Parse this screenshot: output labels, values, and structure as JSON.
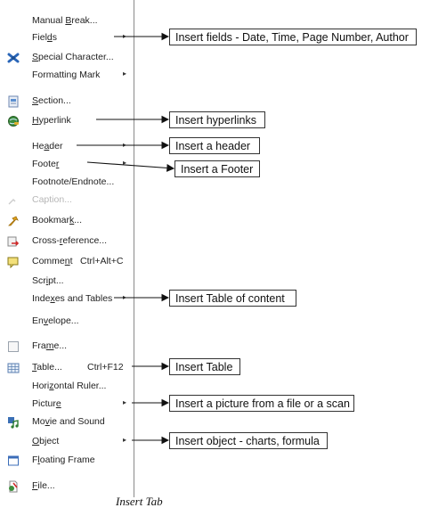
{
  "menu": {
    "items": [
      {
        "pre": "Manual ",
        "acc": "B",
        "post": "reak...",
        "icon": "",
        "shortcut": "",
        "submenu": false,
        "disabled": false
      },
      {
        "pre": "Fiel",
        "acc": "d",
        "post": "s",
        "icon": "",
        "shortcut": "",
        "submenu": true,
        "disabled": false
      },
      {
        "pre": "",
        "acc": "S",
        "post": "pecial Character...",
        "icon": "special-character-icon",
        "shortcut": "",
        "submenu": false,
        "disabled": false
      },
      {
        "pre": "Formatting Mark",
        "acc": "",
        "post": "",
        "icon": "",
        "shortcut": "",
        "submenu": true,
        "disabled": false
      },
      {
        "pre": "",
        "acc": "S",
        "post": "ection...",
        "icon": "section-icon",
        "shortcut": "",
        "submenu": false,
        "disabled": false
      },
      {
        "pre": "",
        "acc": "H",
        "post": "yperlink",
        "icon": "hyperlink-icon",
        "shortcut": "",
        "submenu": false,
        "disabled": false
      },
      {
        "pre": "He",
        "acc": "a",
        "post": "der",
        "icon": "",
        "shortcut": "",
        "submenu": true,
        "disabled": false
      },
      {
        "pre": "Foote",
        "acc": "r",
        "post": "",
        "icon": "",
        "shortcut": "",
        "submenu": true,
        "disabled": false
      },
      {
        "pre": "Footnote/Endnote",
        "acc": "",
        "post": "...",
        "icon": "",
        "shortcut": "",
        "submenu": false,
        "disabled": false
      },
      {
        "pre": "Caption...",
        "acc": "",
        "post": "",
        "icon": "caption-icon",
        "shortcut": "",
        "submenu": false,
        "disabled": true
      },
      {
        "pre": "Bookmar",
        "acc": "k",
        "post": "...",
        "icon": "bookmark-icon",
        "shortcut": "",
        "submenu": false,
        "disabled": false
      },
      {
        "pre": "Cross-",
        "acc": "r",
        "post": "eference...",
        "icon": "cross-reference-icon",
        "shortcut": "",
        "submenu": false,
        "disabled": false
      },
      {
        "pre": "Comme",
        "acc": "n",
        "post": "t",
        "icon": "comment-icon",
        "shortcut": "Ctrl+Alt+C",
        "submenu": false,
        "disabled": false
      },
      {
        "pre": "Scr",
        "acc": "i",
        "post": "pt...",
        "icon": "",
        "shortcut": "",
        "submenu": false,
        "disabled": false
      },
      {
        "pre": "Inde",
        "acc": "x",
        "post": "es and Tables",
        "icon": "",
        "shortcut": "",
        "submenu": true,
        "disabled": false
      },
      {
        "pre": "En",
        "acc": "v",
        "post": "elope...",
        "icon": "",
        "shortcut": "",
        "submenu": false,
        "disabled": false
      },
      {
        "pre": "Fra",
        "acc": "m",
        "post": "e...",
        "icon": "frame-icon",
        "shortcut": "",
        "submenu": false,
        "disabled": false
      },
      {
        "pre": "",
        "acc": "T",
        "post": "able...",
        "icon": "table-icon",
        "shortcut": "Ctrl+F12",
        "submenu": false,
        "disabled": false
      },
      {
        "pre": "Hori",
        "acc": "z",
        "post": "ontal Ruler...",
        "icon": "",
        "shortcut": "",
        "submenu": false,
        "disabled": false
      },
      {
        "pre": "Pictur",
        "acc": "e",
        "post": "",
        "icon": "",
        "shortcut": "",
        "submenu": true,
        "disabled": false
      },
      {
        "pre": "Mo",
        "acc": "v",
        "post": "ie and Sound",
        "icon": "movie-sound-icon",
        "shortcut": "",
        "submenu": false,
        "disabled": false
      },
      {
        "pre": "",
        "acc": "O",
        "post": "bject",
        "icon": "",
        "shortcut": "",
        "submenu": true,
        "disabled": false
      },
      {
        "pre": "F",
        "acc": "l",
        "post": "oating Frame",
        "icon": "floating-frame-icon",
        "shortcut": "",
        "submenu": false,
        "disabled": false
      },
      {
        "pre": "",
        "acc": "F",
        "post": "ile...",
        "icon": "file-icon",
        "shortcut": "",
        "submenu": false,
        "disabled": false
      }
    ],
    "submenu_glyph": "▸"
  },
  "callouts": [
    {
      "item": 1,
      "text": "Insert fields - Date, Time, Page Number, Author"
    },
    {
      "item": 5,
      "text": "Insert hyperlinks"
    },
    {
      "item": 6,
      "text": "Insert a header"
    },
    {
      "item": 7,
      "text": "Insert a Footer"
    },
    {
      "item": 14,
      "text": "Insert Table of content"
    },
    {
      "item": 17,
      "text": "Insert Table"
    },
    {
      "item": 19,
      "text": "Insert a picture from a file or a scan"
    },
    {
      "item": 21,
      "text": "Insert object - charts, formula"
    }
  ],
  "caption": "Insert Tab",
  "colors": {
    "divider": "#8a8a8a",
    "text": "#222222",
    "disabled": "#b7b7b7",
    "callout_border": "#333333"
  }
}
